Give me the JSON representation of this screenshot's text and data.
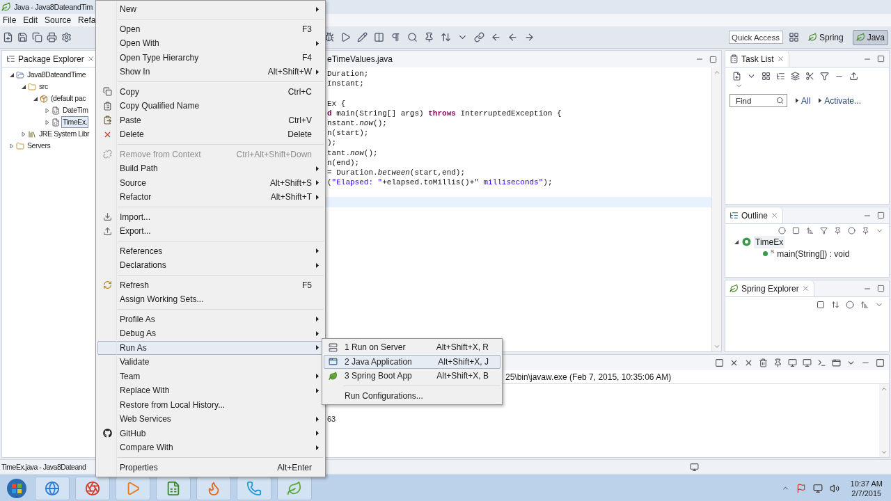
{
  "window": {
    "title": "Java - Java8DateandTim"
  },
  "menubar": [
    "File",
    "Edit",
    "Source",
    "Refa"
  ],
  "quick_access": {
    "placeholder": "Quick Access"
  },
  "perspectives": [
    {
      "label": "Spring",
      "selected": false
    },
    {
      "label": "Java",
      "selected": true
    }
  ],
  "package_explorer": {
    "title": "Package Explorer",
    "tree": [
      {
        "label": "Java8DateandTime",
        "kind": "project",
        "expanded": true,
        "selected": false,
        "children": [
          {
            "label": "src",
            "kind": "folder",
            "expanded": true,
            "selected": false,
            "children": [
              {
                "label": "(default pac",
                "kind": "package",
                "expanded": true,
                "selected": false,
                "children": [
                  {
                    "label": "DateTim",
                    "kind": "file",
                    "expanded": false,
                    "selected": false
                  },
                  {
                    "label": "TimeEx.",
                    "kind": "file",
                    "expanded": false,
                    "selected": true
                  }
                ]
              }
            ]
          },
          {
            "label": "JRE System Libr",
            "kind": "library",
            "expanded": false,
            "selected": false
          }
        ]
      },
      {
        "label": "Servers",
        "kind": "folder",
        "expanded": false,
        "selected": false
      }
    ]
  },
  "editor": {
    "tab": "eTimeValues.java",
    "lines": [
      {
        "kind": "code",
        "tokens": [
          {
            "text": "Duration;",
            "kind": "plain"
          }
        ]
      },
      {
        "kind": "code",
        "tokens": [
          {
            "text": "Instant;",
            "kind": "plain"
          }
        ]
      },
      {
        "kind": "blank"
      },
      {
        "kind": "code",
        "tokens": [
          {
            "text": "Ex {",
            "kind": "plain"
          }
        ]
      },
      {
        "kind": "code",
        "tokens": [
          {
            "text": "d",
            "kind": "keyword"
          },
          {
            "text": " main(String[] args) ",
            "kind": "plain"
          },
          {
            "text": "throws",
            "kind": "keyword"
          },
          {
            "text": " InterruptedException {",
            "kind": "plain"
          }
        ]
      },
      {
        "kind": "code",
        "tokens": [
          {
            "text": "nstant.",
            "kind": "plain"
          },
          {
            "text": "now",
            "kind": "italic"
          },
          {
            "text": "();",
            "kind": "plain"
          }
        ]
      },
      {
        "kind": "code",
        "tokens": [
          {
            "text": "n(start);",
            "kind": "plain"
          }
        ]
      },
      {
        "kind": "code",
        "tokens": [
          {
            "text": ");",
            "kind": "plain"
          }
        ]
      },
      {
        "kind": "code",
        "tokens": [
          {
            "text": "tant.",
            "kind": "plain"
          },
          {
            "text": "now",
            "kind": "italic"
          },
          {
            "text": "();",
            "kind": "plain"
          }
        ]
      },
      {
        "kind": "code",
        "tokens": [
          {
            "text": "n(end);",
            "kind": "plain"
          }
        ]
      },
      {
        "kind": "code",
        "tokens": [
          {
            "text": "= Duration.",
            "kind": "plain"
          },
          {
            "text": "between",
            "kind": "italic"
          },
          {
            "text": "(start,end);",
            "kind": "plain"
          }
        ]
      },
      {
        "kind": "code",
        "tokens": [
          {
            "text": "(",
            "kind": "plain"
          },
          {
            "text": "\"Elapsed: \"",
            "kind": "string"
          },
          {
            "text": "+elapsed.toMillis()+",
            "kind": "plain"
          },
          {
            "text": "\" milliseconds\"",
            "kind": "string"
          },
          {
            "text": ");",
            "kind": "plain"
          }
        ]
      },
      {
        "kind": "current"
      }
    ]
  },
  "task_list": {
    "title": "Task List",
    "find_placeholder": "Find",
    "links": [
      "All",
      "Activate..."
    ]
  },
  "outline": {
    "title": "Outline",
    "tree": [
      {
        "label": "TimeEx",
        "kind": "class",
        "expanded": true,
        "children": [
          {
            "label": "main(String[]) : void",
            "kind": "method",
            "marker": "S"
          }
        ]
      }
    ]
  },
  "spring_explorer": {
    "title": "Spring Explorer"
  },
  "console": {
    "header": "25\\bin\\javaw.exe (Feb 7, 2015, 10:35:06 AM)",
    "output": "63"
  },
  "status_bar": {
    "text": "TimeEx.java - Java8Dateand"
  },
  "context_menu": {
    "groups": [
      [
        {
          "label": "New",
          "kind": "plain",
          "submenu": true,
          "selected": false,
          "disabled": false
        }
      ],
      [
        {
          "label": "Open",
          "shortcut": "F3",
          "kind": "plain",
          "submenu": false,
          "selected": false,
          "disabled": false
        },
        {
          "label": "Open With",
          "kind": "plain",
          "submenu": true,
          "selected": false,
          "disabled": false
        },
        {
          "label": "Open Type Hierarchy",
          "shortcut": "F4",
          "kind": "plain",
          "submenu": false,
          "selected": false,
          "disabled": false
        },
        {
          "label": "Show In",
          "shortcut": "Alt+Shift+W",
          "kind": "plain",
          "submenu": true,
          "selected": false,
          "disabled": false
        }
      ],
      [
        {
          "label": "Copy",
          "shortcut": "Ctrl+C",
          "kind": "copy",
          "submenu": false,
          "selected": false,
          "disabled": false
        },
        {
          "label": "Copy Qualified Name",
          "kind": "qualified",
          "submenu": false,
          "selected": false,
          "disabled": false
        },
        {
          "label": "Paste",
          "shortcut": "Ctrl+V",
          "kind": "paste",
          "submenu": false,
          "selected": false,
          "disabled": false
        },
        {
          "label": "Delete",
          "shortcut": "Delete",
          "kind": "delete",
          "submenu": false,
          "selected": false,
          "disabled": false
        }
      ],
      [
        {
          "label": "Remove from Context",
          "shortcut": "Ctrl+Alt+Shift+Down",
          "kind": "unlink",
          "submenu": false,
          "selected": false,
          "disabled": true
        },
        {
          "label": "Build Path",
          "kind": "plain",
          "submenu": true,
          "selected": false,
          "disabled": false
        },
        {
          "label": "Source",
          "shortcut": "Alt+Shift+S",
          "kind": "plain",
          "submenu": true,
          "selected": false,
          "disabled": false
        },
        {
          "label": "Refactor",
          "shortcut": "Alt+Shift+T",
          "kind": "plain",
          "submenu": true,
          "selected": false,
          "disabled": false
        }
      ],
      [
        {
          "label": "Import...",
          "kind": "import",
          "submenu": false,
          "selected": false,
          "disabled": false
        },
        {
          "label": "Export...",
          "kind": "export",
          "submenu": false,
          "selected": false,
          "disabled": false
        }
      ],
      [
        {
          "label": "References",
          "kind": "plain",
          "submenu": true,
          "selected": false,
          "disabled": false
        },
        {
          "label": "Declarations",
          "kind": "plain",
          "submenu": true,
          "selected": false,
          "disabled": false
        }
      ],
      [
        {
          "label": "Refresh",
          "shortcut": "F5",
          "kind": "refresh",
          "submenu": false,
          "selected": false,
          "disabled": false
        },
        {
          "label": "Assign Working Sets...",
          "kind": "plain",
          "submenu": false,
          "selected": false,
          "disabled": false
        }
      ],
      [
        {
          "label": "Profile As",
          "kind": "plain",
          "submenu": true,
          "selected": false,
          "disabled": false
        },
        {
          "label": "Debug As",
          "kind": "plain",
          "submenu": true,
          "selected": false,
          "disabled": false
        },
        {
          "label": "Run As",
          "kind": "plain",
          "submenu": true,
          "selected": true,
          "disabled": false
        },
        {
          "label": "Validate",
          "kind": "plain",
          "submenu": false,
          "selected": false,
          "disabled": false
        },
        {
          "label": "Team",
          "kind": "plain",
          "submenu": true,
          "selected": false,
          "disabled": false
        },
        {
          "label": "Replace With",
          "kind": "plain",
          "submenu": true,
          "selected": false,
          "disabled": false
        },
        {
          "label": "Restore from Local History...",
          "kind": "plain",
          "submenu": false,
          "selected": false,
          "disabled": false
        },
        {
          "label": "Web Services",
          "kind": "plain",
          "submenu": true,
          "selected": false,
          "disabled": false
        },
        {
          "label": "GitHub",
          "kind": "github",
          "submenu": true,
          "selected": false,
          "disabled": false
        },
        {
          "label": "Compare With",
          "kind": "plain",
          "submenu": true,
          "selected": false,
          "disabled": false
        }
      ],
      [
        {
          "label": "Properties",
          "shortcut": "Alt+Enter",
          "kind": "plain",
          "submenu": false,
          "selected": false,
          "disabled": false
        }
      ]
    ]
  },
  "submenu": {
    "groups": [
      [
        {
          "label": "1 Run on Server",
          "shortcut": "Alt+Shift+X, R",
          "kind": "server",
          "selected": false
        },
        {
          "label": "2 Java Application",
          "shortcut": "Alt+Shift+X, J",
          "kind": "app",
          "selected": true
        },
        {
          "label": "3 Spring Boot App",
          "shortcut": "Alt+Shift+X, B",
          "kind": "leaf",
          "selected": false
        }
      ],
      [
        {
          "label": "Run Configurations...",
          "kind": "plain",
          "selected": false
        }
      ]
    ]
  },
  "taskbar": {
    "time": "10:37 AM",
    "date": "2/7/2015"
  }
}
